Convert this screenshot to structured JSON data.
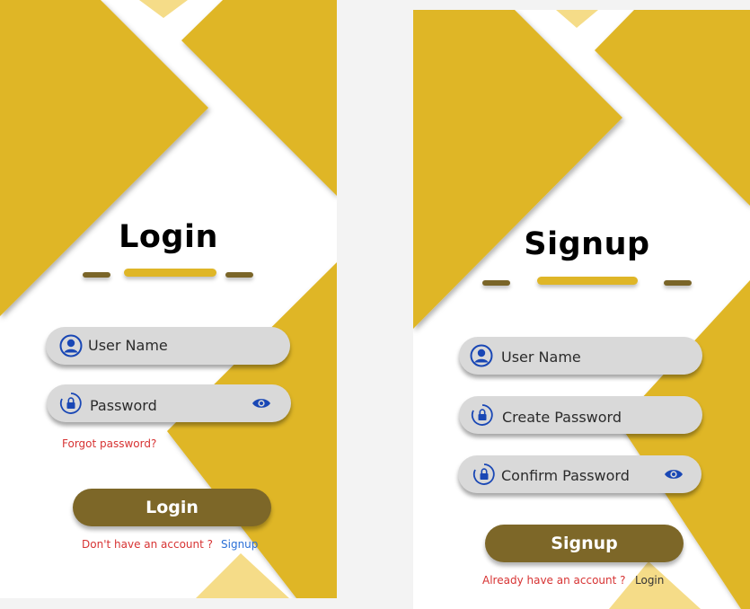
{
  "login": {
    "title": "Login",
    "username_placeholder": "User Name",
    "password_placeholder": "Password",
    "forgot_password": "Forgot password?",
    "button": "Login",
    "no_account_text": "Don't have an account ?",
    "signup_link": "Signup"
  },
  "signup": {
    "title": "Signup",
    "username_placeholder": "User Name",
    "create_password_placeholder": "Create Password",
    "confirm_password_placeholder": "Confirm Password",
    "button": "Signup",
    "have_account_text": "Already have an account ?",
    "login_link": "Login"
  },
  "colors": {
    "gold": "#dfb627",
    "light_gold": "#f5dc88",
    "dark_gold": "#7d6728",
    "field_bg": "#d9d9d9",
    "link_red": "#d73333",
    "link_blue": "#2a6fd6",
    "icon_blue": "#1947b5"
  },
  "icons": {
    "user": "user-icon",
    "lock": "lock-icon",
    "eye": "eye-icon"
  }
}
